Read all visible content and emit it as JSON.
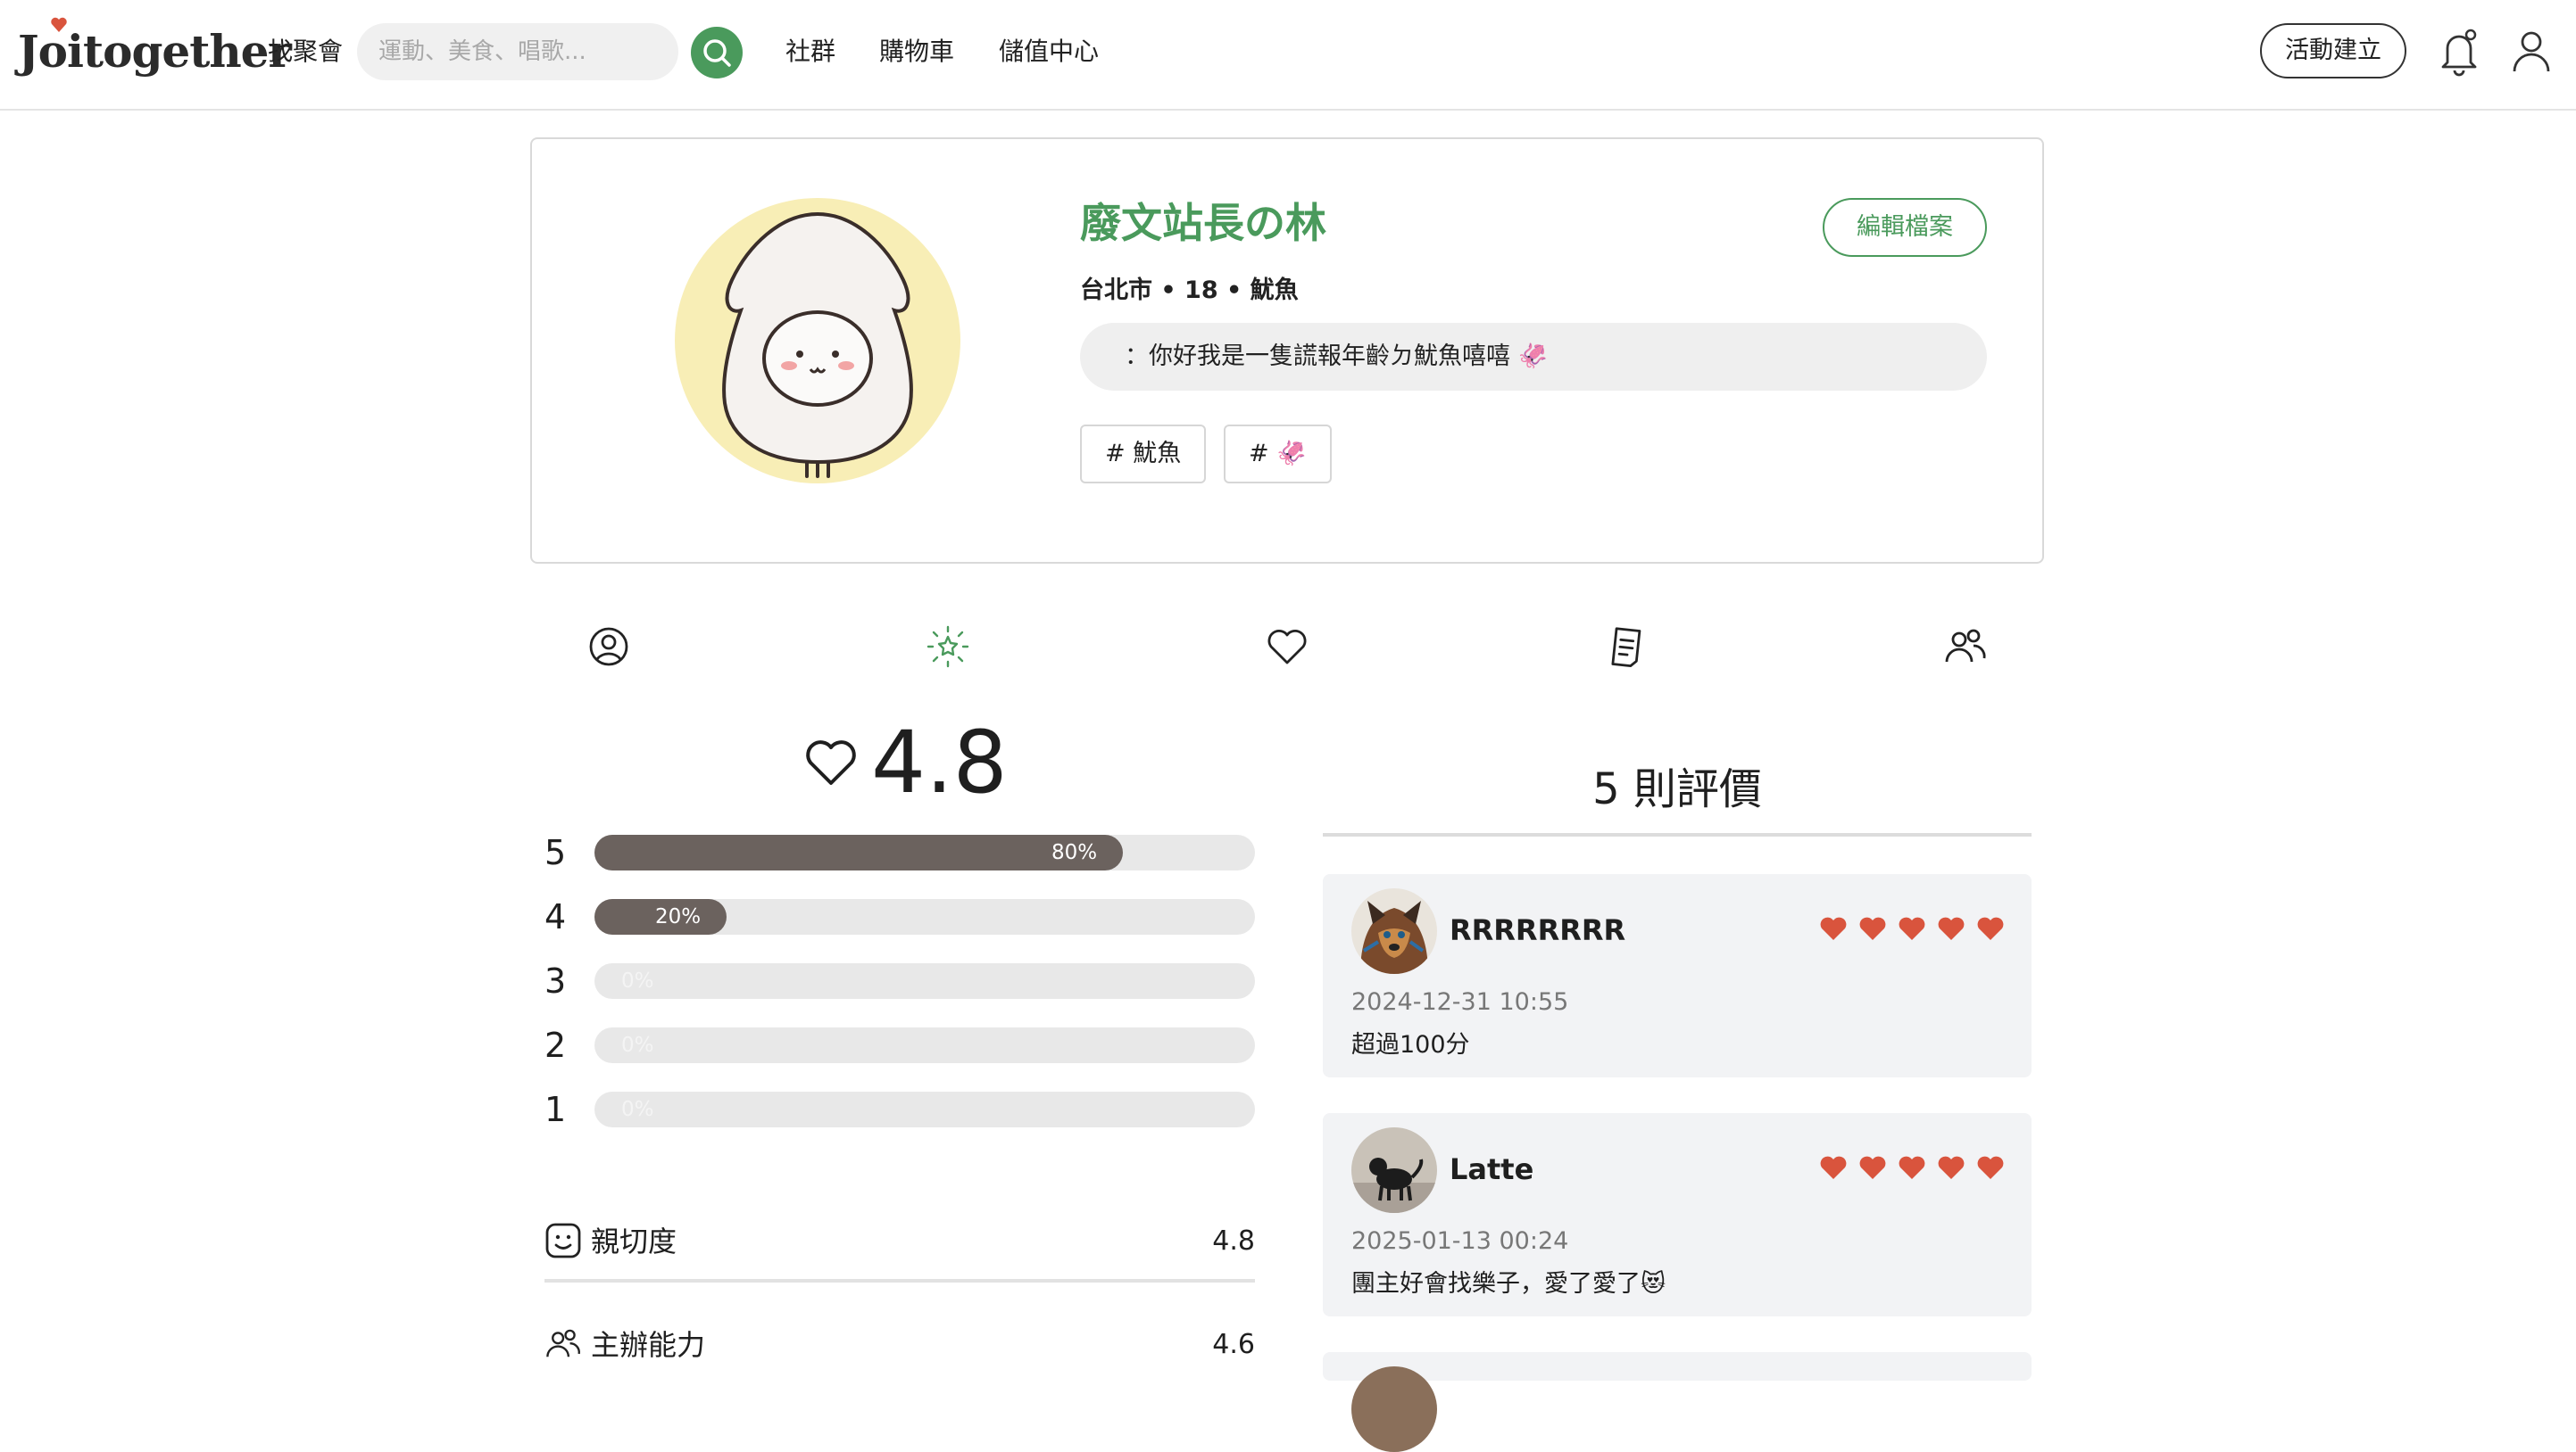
{
  "header": {
    "logo_text": "Joitogether",
    "find_label": "找聚會",
    "search_placeholder": "運動、美食、唱歌...",
    "nav_links": [
      "社群",
      "購物車",
      "儲值中心"
    ],
    "create_label": "活動建立",
    "icons": {
      "search": "search-icon",
      "bell": "bell-icon",
      "user": "user-icon"
    }
  },
  "profile": {
    "name": "廢文站長の林",
    "edit_label": "編輯檔案",
    "meta": "台北市 • 18 • 魷魚",
    "bio": "：你好我是一隻謊報年齡ㄉ魷魚嘻嘻 🦑",
    "tags": [
      "# 魷魚",
      "# 🦑"
    ]
  },
  "tabs": [
    "profile-tab",
    "rating-tab",
    "favorites-tab",
    "posts-tab",
    "groups-tab"
  ],
  "rating": {
    "average": "4.8",
    "distribution": [
      {
        "star": "5",
        "pct_label": "80%",
        "pct": 80
      },
      {
        "star": "4",
        "pct_label": "20%",
        "pct": 20
      },
      {
        "star": "3",
        "pct_label": "0%",
        "pct": 0
      },
      {
        "star": "2",
        "pct_label": "0%",
        "pct": 0
      },
      {
        "star": "1",
        "pct_label": "0%",
        "pct": 0
      }
    ],
    "criteria": [
      {
        "label": "親切度",
        "value": "4.8"
      },
      {
        "label": "主辦能力",
        "value": "4.6"
      }
    ]
  },
  "reviews": {
    "title": "5 則評價",
    "items": [
      {
        "name": "RRRRRRRR",
        "date": "2024-12-31 10:55",
        "text": "超過100分",
        "hearts": 5
      },
      {
        "name": "Latte",
        "date": "2025-01-13 00:24",
        "text": "團主好會找樂子，愛了愛了😻",
        "hearts": 5
      }
    ]
  },
  "colors": {
    "brand_green": "#4a9a5c",
    "bar_fill": "#6b625e",
    "heart_red": "#d9543d",
    "avatar_bg": "#f8eeb6"
  }
}
